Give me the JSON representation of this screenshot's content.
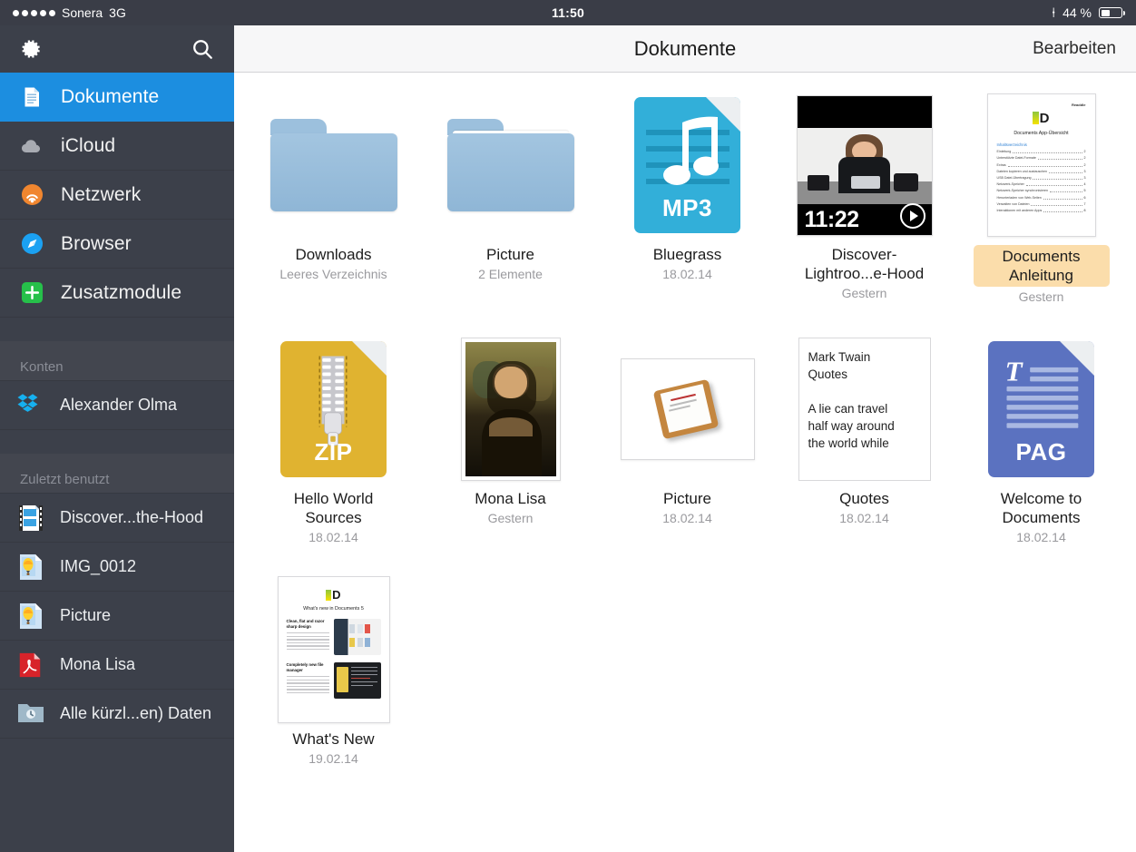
{
  "status_bar": {
    "carrier": "Sonera",
    "network": "3G",
    "signal_dots": 5,
    "time": "11:50",
    "bluetooth_icon": "bluetooth-icon",
    "battery_percent": "44 %",
    "battery_level": 44
  },
  "sidebar": {
    "settings_icon": "gear-icon",
    "search_icon": "search-icon",
    "accent_color": "#1c8ee0",
    "background_color": "#3c404a",
    "items": [
      {
        "label": "Dokumente",
        "icon": "document-icon",
        "active": true
      },
      {
        "label": "iCloud",
        "icon": "cloud-icon",
        "active": false
      },
      {
        "label": "Netzwerk",
        "icon": "network-icon",
        "active": false
      },
      {
        "label": "Browser",
        "icon": "compass-icon",
        "active": false
      },
      {
        "label": "Zusatzmodule",
        "icon": "plus-square-icon",
        "active": false
      }
    ],
    "accounts_header": "Konten",
    "accounts": [
      {
        "label": "Alexander Olma",
        "icon": "dropbox-icon"
      }
    ],
    "recents_header": "Zuletzt benutzt",
    "recents": [
      {
        "label": "Discover...the-Hood",
        "icon": "video-file-icon"
      },
      {
        "label": "IMG_0012",
        "icon": "image-file-icon"
      },
      {
        "label": "Picture",
        "icon": "image-file-icon"
      },
      {
        "label": "Mona Lisa",
        "icon": "pdf-file-icon"
      },
      {
        "label": "Alle kürzl...en) Daten",
        "icon": "recent-folder-icon"
      }
    ]
  },
  "navbar": {
    "title": "Dokumente",
    "edit_label": "Bearbeiten"
  },
  "files": [
    {
      "name": "Downloads",
      "subtitle": "Leeres Verzeichnis",
      "kind": "folder",
      "has_contents": false,
      "selected": false
    },
    {
      "name": "Picture",
      "subtitle": "2 Elemente",
      "kind": "folder",
      "has_contents": true,
      "selected": false
    },
    {
      "name": "Bluegrass",
      "subtitle": "18.02.14",
      "kind": "doctype",
      "ext_label": "MP3",
      "color": "#32afd9",
      "glyph": "music-note-icon",
      "selected": false
    },
    {
      "name": "Discover-Lightroo...e-Hood",
      "subtitle": "Gestern",
      "kind": "video",
      "duration": "11:22",
      "selected": false
    },
    {
      "name": "Documents Anleitung",
      "subtitle": "Gestern",
      "kind": "page-preview",
      "selected": true,
      "highlight_color": "#fbddab",
      "preview": {
        "brand": "Readdle",
        "logo": "D",
        "title": "Documents App-Übersicht",
        "section": "Inhaltsverzeichnis",
        "toc": [
          {
            "entry": "Einleitung",
            "page": "2"
          },
          {
            "entry": "Unterstützte Datei-Formate",
            "page": "2"
          },
          {
            "entry": "Extras",
            "page": "2"
          },
          {
            "entry": "Dateien kopieren und austauschen",
            "page": "3"
          },
          {
            "entry": "USB Datei-Übertragung",
            "page": "3"
          },
          {
            "entry": "Netzwerk-Speicher",
            "page": "4"
          },
          {
            "entry": "Netzwerk-Speicher synchronisieren",
            "page": "5"
          },
          {
            "entry": "Herunterladen von Web-Seiten",
            "page": "6"
          },
          {
            "entry": "Verwalten von Dateien",
            "page": "7"
          },
          {
            "entry": "Interaktionen mit anderen Apps",
            "page": "8"
          }
        ]
      }
    },
    {
      "name": "Hello World Sources",
      "subtitle": "18.02.14",
      "kind": "doctype",
      "ext_label": "ZIP",
      "color": "#e0b330",
      "glyph": "zipper-icon",
      "selected": false
    },
    {
      "name": "Mona Lisa",
      "subtitle": "Gestern",
      "kind": "painting",
      "selected": false
    },
    {
      "name": "Picture",
      "subtitle": "18.02.14",
      "kind": "picture",
      "selected": false
    },
    {
      "name": "Quotes",
      "subtitle": "18.02.14",
      "kind": "text-preview",
      "selected": false,
      "text_lines": [
        "Mark Twain",
        "Quotes",
        "",
        "A lie can travel",
        "half way around",
        "the world while"
      ]
    },
    {
      "name": "Welcome to Documents",
      "subtitle": "18.02.14",
      "kind": "doctype",
      "ext_label": "PAG",
      "color": "#5b72c0",
      "glyph": "text-T-icon",
      "selected": false
    },
    {
      "name": "What's New",
      "subtitle": "19.02.14",
      "kind": "whatsnew-preview",
      "selected": false,
      "preview": {
        "logo": "D",
        "title": "What's new in Documents 5",
        "sections": [
          "Clean, flat and razor sharp design",
          "Completely new file manager"
        ]
      }
    }
  ]
}
